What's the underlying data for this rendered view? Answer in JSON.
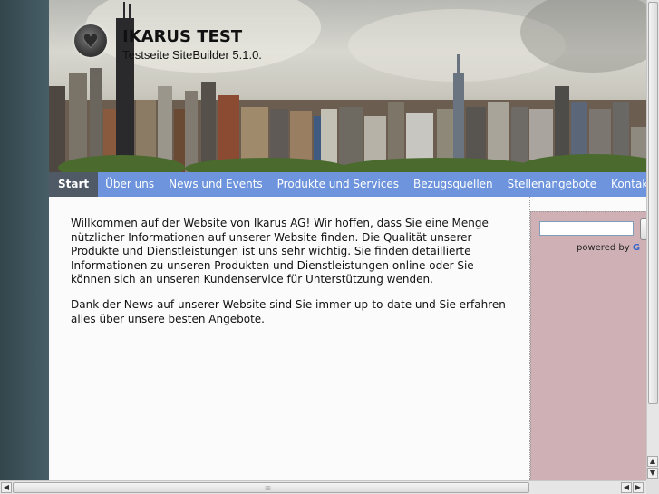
{
  "site": {
    "title": "IKARUS TEST",
    "subtitle": "Testseite SiteBuilder 5.1.0."
  },
  "nav": {
    "items": [
      {
        "label": "Start",
        "active": true
      },
      {
        "label": "Über uns"
      },
      {
        "label": "News und Events"
      },
      {
        "label": "Produkte und Services"
      },
      {
        "label": "Bezugsquellen"
      },
      {
        "label": "Stellenangebote"
      },
      {
        "label": "Kontakt"
      }
    ]
  },
  "content": {
    "paragraph1": "Willkommen auf der Website von Ikarus AG! Wir hoffen, dass Sie eine Menge nützlicher Informationen auf unserer Website finden. Die Qualität unserer Produkte und Dienstleistungen ist uns sehr wichtig. Sie finden detaillierte Informationen zu unseren Produkten und Dienstleistungen online oder Sie können sich an unseren Kundenservice für Unterstützung wenden.",
    "paragraph2": "Dank der News auf unserer Website sind Sie immer up-to-date und Sie erfahren alles über unsere besten Angebote."
  },
  "sidebar": {
    "search_value": "",
    "powered_text": "powered by",
    "powered_brand": "G"
  },
  "icons": {
    "logo": "heart-icon",
    "scroll_up": "arrow-up-icon",
    "scroll_down": "arrow-down-icon",
    "scroll_left": "arrow-left-icon",
    "scroll_right": "arrow-right-icon"
  },
  "colors": {
    "nav_bg": "#6d94dc",
    "nav_active": "#4f5a66",
    "sidebar_bg": "#cfb1b5",
    "page_bg": "#fbfbfb"
  }
}
